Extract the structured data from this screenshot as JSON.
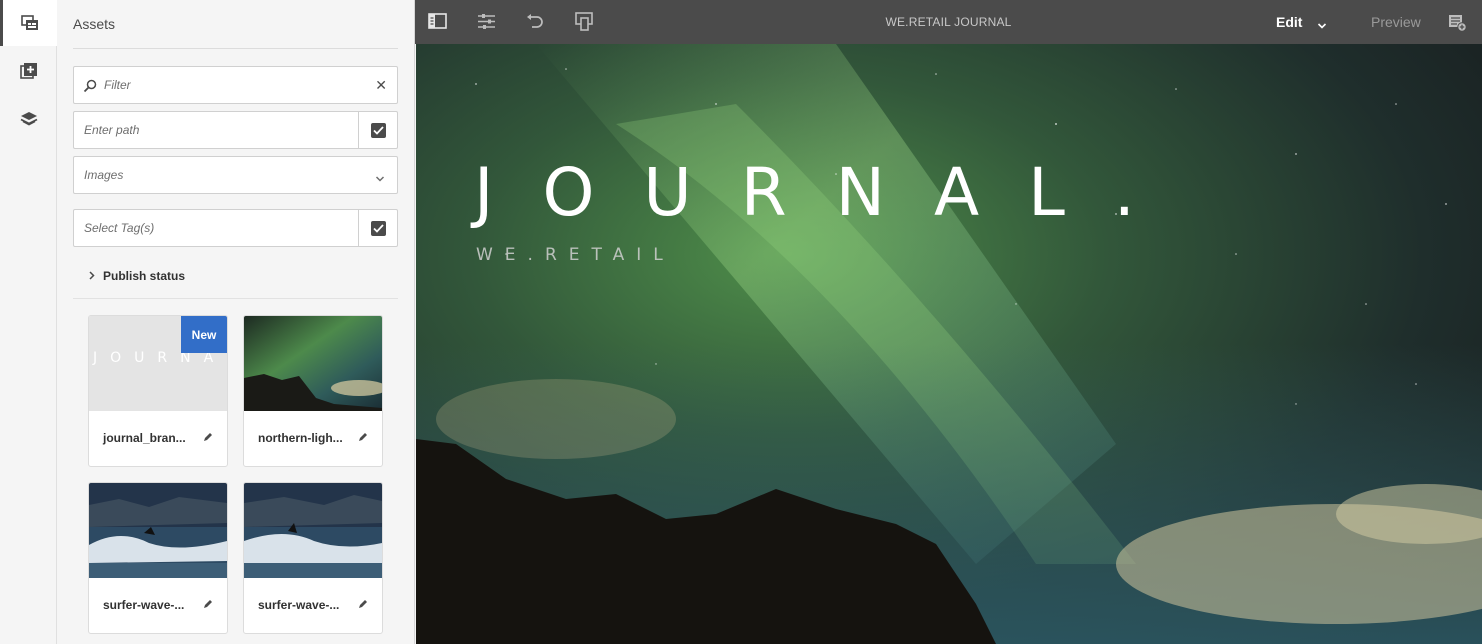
{
  "panel": {
    "title": "Assets",
    "filter_placeholder": "Filter",
    "path_placeholder": "Enter path",
    "type_select_value": "Images",
    "tags_placeholder": "Select Tag(s)",
    "publish_status_label": "Publish status"
  },
  "assets": [
    {
      "name": "journal_bran...",
      "badge": "New",
      "thumb_text": "JOURNAL"
    },
    {
      "name": "northern-ligh..."
    },
    {
      "name": "surfer-wave-..."
    },
    {
      "name": "surfer-wave-..."
    }
  ],
  "toolbar": {
    "page_title": "WE.RETAIL JOURNAL",
    "mode_label": "Edit",
    "preview_label": "Preview"
  },
  "hero": {
    "title": "JOURNAL.",
    "subtitle": "WE.RETAIL"
  },
  "colors": {
    "toolbar_bg": "#4b4b4b",
    "badge_blue": "#326ec8",
    "panel_bg": "#f5f5f5"
  }
}
